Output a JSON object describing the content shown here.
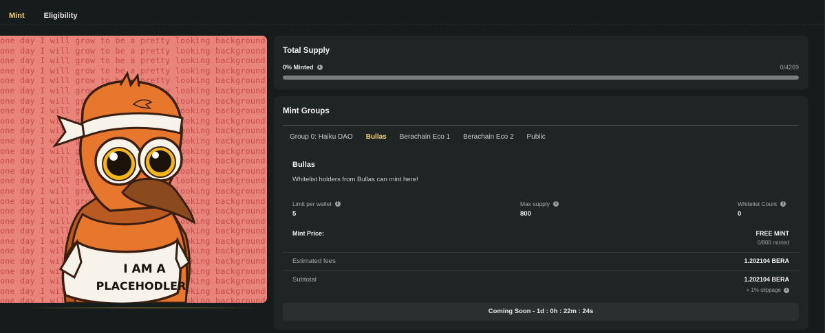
{
  "nav": {
    "tabs": [
      {
        "label": "Mint",
        "active": true
      },
      {
        "label": "Eligibility",
        "active": false
      }
    ]
  },
  "artwork": {
    "background_text": "one day I will grow to be a pretty looking background",
    "shirt_line1": "I AM A",
    "shirt_line2": "PLACEHODLER",
    "colors": {
      "bg": "#e8847a",
      "text": "#c64b4b",
      "bird": "#e8772e"
    }
  },
  "total_supply": {
    "title": "Total Supply",
    "minted_label": "0% Minted",
    "minted_count": "0/4269",
    "progress_fraction": 0
  },
  "mint_groups": {
    "title": "Mint Groups",
    "tabs": [
      {
        "label": "Group 0: Haiku DAO",
        "active": false
      },
      {
        "label": "Bullas",
        "active": true
      },
      {
        "label": "Berachain Eco 1",
        "active": false
      },
      {
        "label": "Berachain Eco 2",
        "active": false
      },
      {
        "label": "Public",
        "active": false
      }
    ],
    "selected": {
      "name": "Bullas",
      "description": "Whitelist holders from Bullas can mint here!",
      "stats": [
        {
          "label": "Limit per wallet",
          "value": "5"
        },
        {
          "label": "Max supply",
          "value": "800"
        },
        {
          "label": "Whitelist Count",
          "value": "0"
        }
      ],
      "mint_price_label": "Mint Price:",
      "mint_price_value": "FREE MINT",
      "minted_status": "0/800 minted",
      "fees_label": "Estimated fees",
      "fees_value": "1.202104 BERA",
      "subtotal_label": "Subtotal",
      "subtotal_value": "1.202104 BERA",
      "slippage": "+ 1% slippage",
      "cta": "Coming Soon - 1d : 0h : 22m : 24s"
    }
  },
  "accent_color": "#f4d27a"
}
